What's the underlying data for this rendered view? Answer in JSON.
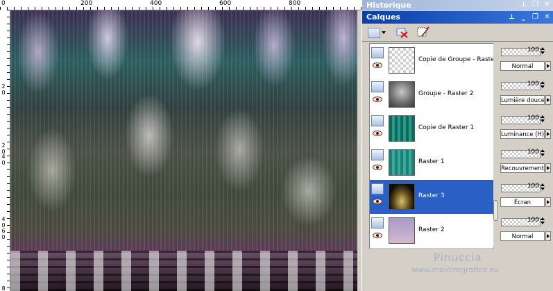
{
  "ruler": {
    "top_ticks": [
      "0",
      "200",
      "400",
      "600",
      "800"
    ],
    "left_ticks": [
      "2",
      "0",
      "2",
      "0",
      "4",
      "0",
      "4",
      "0",
      "6",
      "0",
      "8"
    ]
  },
  "panels": {
    "history_title": "Historique",
    "layers_title": "Calques"
  },
  "icons": {
    "pin": "pin-icon",
    "minimize": "minimize-icon",
    "restore": "restore-icon",
    "close": "close-icon",
    "new_layer": "new-layer-icon",
    "delete": "delete-layer-icon",
    "properties": "layer-properties-icon",
    "visibility": "eye-icon"
  },
  "layers": [
    {
      "name": "Copie de Groupe - Raste",
      "opacity": "100",
      "blend": "Normal",
      "selected": false,
      "thumb": "checker"
    },
    {
      "name": "Groupe - Raster 2",
      "opacity": "100",
      "blend": "Lumière douce",
      "selected": false,
      "thumb": "gray"
    },
    {
      "name": "Copie de Raster 1",
      "opacity": "100",
      "blend": "Luminance (H)",
      "selected": false,
      "thumb": "teal1"
    },
    {
      "name": "Raster 1",
      "opacity": "100",
      "blend": "Recouvrement",
      "selected": false,
      "thumb": "teal2"
    },
    {
      "name": "Raster 3",
      "opacity": "100",
      "blend": "Écran",
      "selected": true,
      "thumb": "dark"
    },
    {
      "name": "Raster 2",
      "opacity": "100",
      "blend": "Normal",
      "selected": false,
      "thumb": "pink"
    }
  ],
  "watermark": {
    "name": "Pinuccia",
    "url": "www.maidiregrafica.eu"
  },
  "colors": {
    "selection": "#2a5fc6",
    "titlebar": "#0a3fa8"
  }
}
